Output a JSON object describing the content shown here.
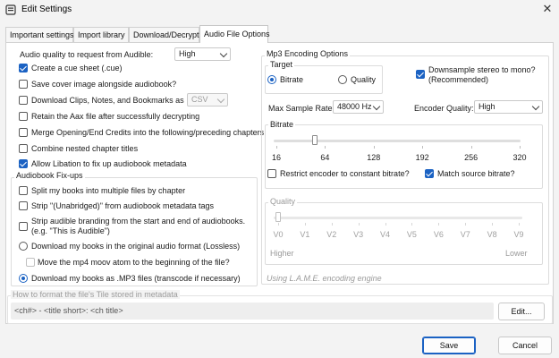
{
  "window": {
    "title": "Edit Settings"
  },
  "tabs": [
    {
      "label": "Important settings"
    },
    {
      "label": "Import library"
    },
    {
      "label": "Download/Decrypt"
    },
    {
      "label": "Audio File Options"
    }
  ],
  "left": {
    "quality_label": "Audio quality to request from Audible:",
    "quality_value": "High",
    "options": [
      {
        "label": "Create a cue sheet (.cue)",
        "checked": true
      },
      {
        "label": "Save cover image alongside audiobook?",
        "checked": false
      },
      {
        "label": "Download Clips, Notes, and Bookmarks as",
        "checked": false
      },
      {
        "label": "Retain the Aax file after successfully decrypting",
        "checked": false
      },
      {
        "label": "Merge Opening/End Credits into the following/preceding chapters",
        "checked": false
      },
      {
        "label": "Combine nested chapter titles",
        "checked": false
      },
      {
        "label": "Allow Libation to fix up audiobook metadata",
        "checked": true
      }
    ],
    "clips_format": "CSV",
    "fixups": {
      "title": "Audiobook Fix-ups",
      "split": "Split my books into multiple files by chapter",
      "strip_unabridged": "Strip \"(Unabridged)\" from audiobook metadata tags",
      "strip_branding_1": "Strip audible branding from the start and end of audiobooks.",
      "strip_branding_2": "(e.g. \"This is Audible\")",
      "original_format": "Download my books in the original audio format (Lossless)",
      "moov_atom": "Move the mp4 moov atom to the beginning of the file?",
      "mp3": "Download my books as .MP3 files (transcode if necessary)"
    }
  },
  "mp3": {
    "title": "Mp3 Encoding Options",
    "target_title": "Target",
    "target_bitrate": "Bitrate",
    "target_quality": "Quality",
    "downsample_1": "Downsample stereo to mono?",
    "downsample_2": "(Recommended)",
    "downsample_checked": true,
    "max_sample_rate_label": "Max Sample Rate:",
    "max_sample_rate_value": "48000 Hz",
    "encoder_quality_label": "Encoder Quality:",
    "encoder_quality_value": "High",
    "bitrate_title": "Bitrate",
    "bitrate_ticks": [
      "16",
      "64",
      "128",
      "192",
      "256",
      "320"
    ],
    "bitrate_value": 64,
    "restrict_cbr": "Restrict encoder to constant bitrate?",
    "restrict_checked": false,
    "match_source": "Match source bitrate?",
    "match_checked": true,
    "quality_title": "Quality",
    "quality_ticks": [
      "V0",
      "V1",
      "V2",
      "V3",
      "V4",
      "V5",
      "V6",
      "V7",
      "V8",
      "V9"
    ],
    "quality_value": "V0",
    "quality_higher": "Higher",
    "quality_lower": "Lower",
    "engine_note": "Using L.A.M.E. encoding engine"
  },
  "file_title": {
    "label": "How to format the file's Tile stored in metadata",
    "template": "<ch#> - <title short>: <ch title>",
    "edit": "Edit..."
  },
  "footer": {
    "save": "Save",
    "cancel": "Cancel"
  },
  "colors": {
    "accent": "#1b62c3"
  }
}
